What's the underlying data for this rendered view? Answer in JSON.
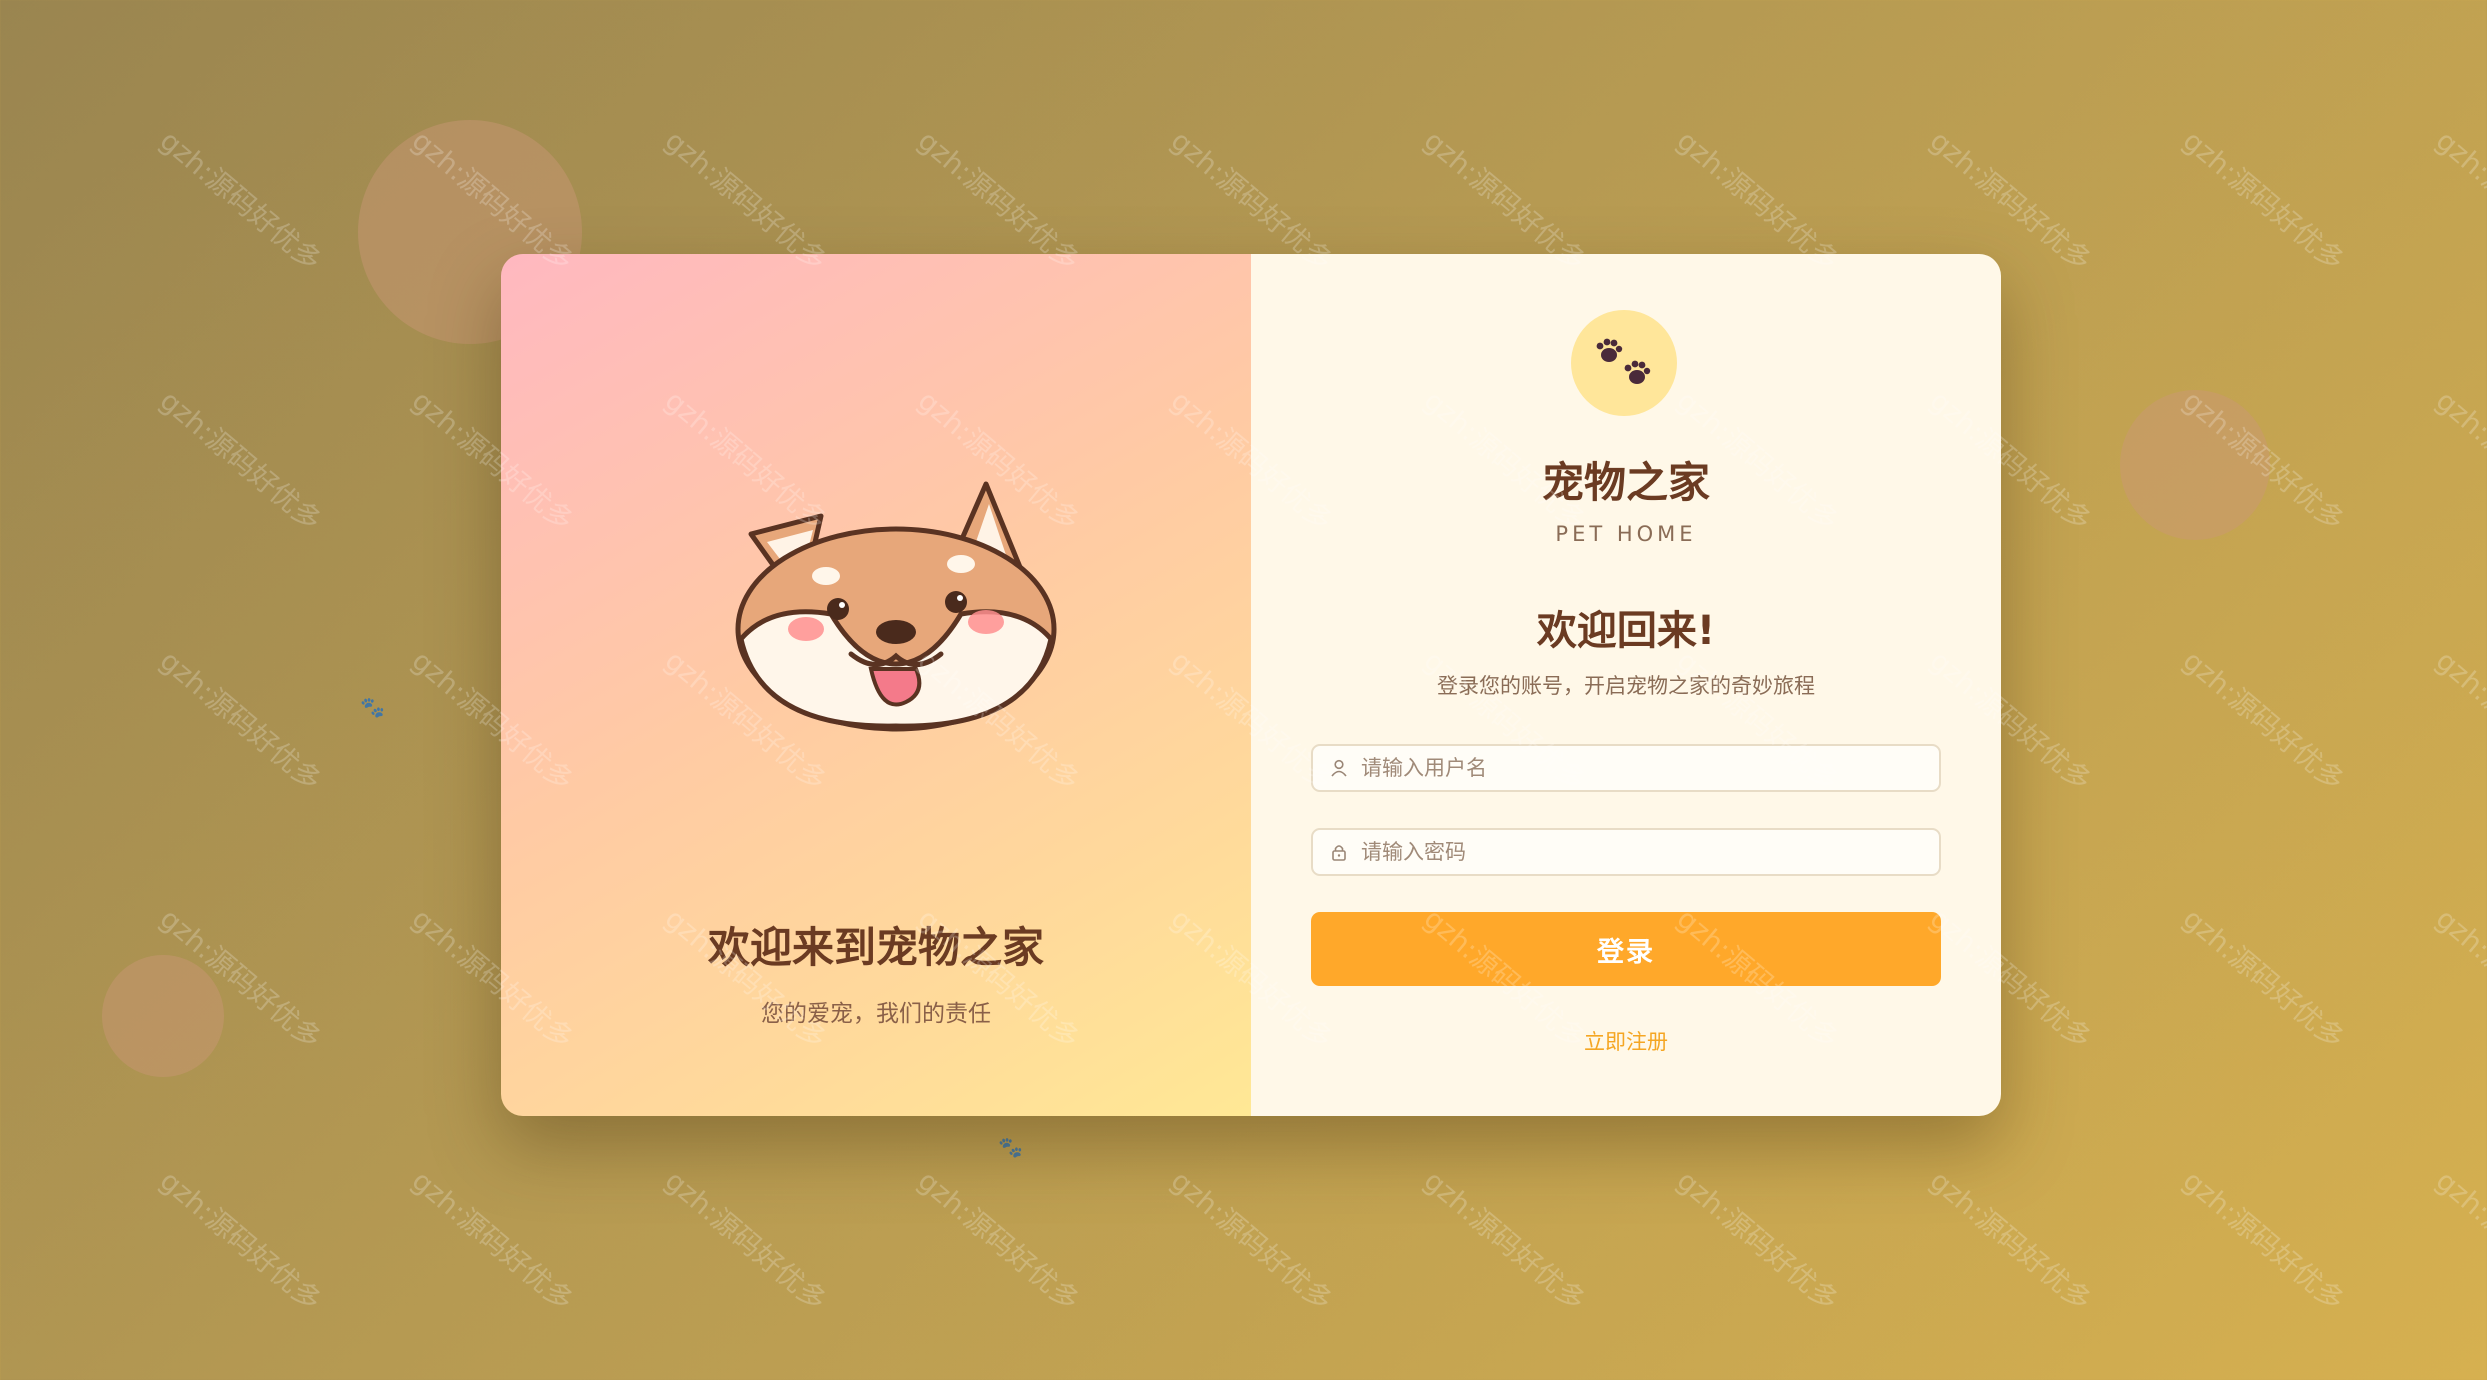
{
  "hero": {
    "title": "欢迎来到宠物之家",
    "subtitle": "您的爱宠，我们的责任"
  },
  "brand": {
    "name": "宠物之家",
    "name_en": "PET HOME",
    "logo_icon": "paw-icon"
  },
  "form": {
    "welcome": "欢迎回来!",
    "welcome_sub": "登录您的账号，开启宠物之家的奇妙旅程",
    "username_placeholder": "请输入用户名",
    "password_placeholder": "请输入密码",
    "login_label": "登录",
    "register_label": "立即注册"
  },
  "watermark": "gzh:源码好优多",
  "colors": {
    "accent": "#ffa82a",
    "title": "#6b3b22",
    "card_right": "#fff8e8"
  }
}
